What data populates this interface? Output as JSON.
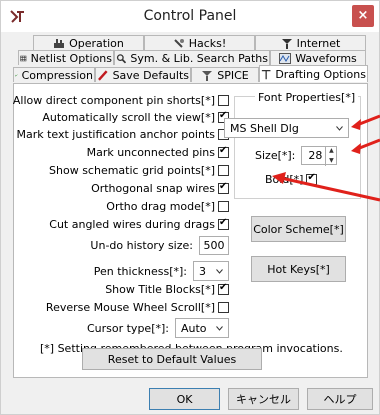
{
  "window": {
    "title": "Control Panel",
    "close_symbol": "×",
    "app_icon": "app-logo-icon"
  },
  "tabs": {
    "row1": [
      {
        "label": "Operation",
        "icon": "operation-icon"
      },
      {
        "label": "Hacks!",
        "icon": "hacks-icon"
      },
      {
        "label": "Internet",
        "icon": "internet-icon"
      }
    ],
    "row2": [
      {
        "label": "Netlist Options",
        "icon": "netlist-icon"
      },
      {
        "label": "Sym. & Lib. Search Paths",
        "icon": "search-icon"
      },
      {
        "label": "Waveforms",
        "icon": "waveforms-icon"
      }
    ],
    "row3": [
      {
        "label": "Compression",
        "icon": "compression-icon"
      },
      {
        "label": "Save Defaults",
        "icon": "pencil-icon"
      },
      {
        "label": "SPICE",
        "icon": "spice-icon"
      },
      {
        "label": "Drafting Options",
        "icon": "drafting-icon",
        "active": true
      }
    ]
  },
  "options": {
    "allow_shorts": {
      "label": "Allow direct component pin shorts[*]",
      "checked": false
    },
    "auto_scroll": {
      "label": "Automatically scroll the view[*]",
      "checked": true
    },
    "mark_anchor": {
      "label": "Mark text justification anchor points",
      "checked": false
    },
    "mark_unconnected": {
      "label": "Mark unconnected pins",
      "checked": true
    },
    "show_grid": {
      "label": "Show schematic grid points[*]",
      "checked": false
    },
    "ortho_snap": {
      "label": "Orthogonal snap wires",
      "checked": true
    },
    "ortho_drag": {
      "label": "Ortho drag mode[*]",
      "checked": false
    },
    "cut_angled": {
      "label": "Cut angled wires during drags",
      "checked": true
    },
    "undo_history": {
      "label": "Un-do history size:",
      "value": "500"
    },
    "pen_thickness": {
      "label": "Pen thickness[*]:",
      "value": "3"
    },
    "show_title": {
      "label": "Show Title Blocks[*]",
      "checked": true
    },
    "reverse_scroll": {
      "label": "Reverse Mouse Wheel Scroll[*]",
      "checked": false
    },
    "cursor_type": {
      "label": "Cursor type[*]:",
      "value": "Auto"
    }
  },
  "font_properties": {
    "title": "Font Properties[*]",
    "font": "MS Shell Dlg",
    "size_label": "Size[*]:",
    "size": "28",
    "bold_label": "Bold[*]",
    "bold_checked": true
  },
  "side_buttons": {
    "color_scheme": "Color Scheme[*]",
    "hot_keys": "Hot Keys[*]"
  },
  "note": "[*] Setting remembered between program invocations.",
  "reset_button": "Reset to Default Values",
  "footer": {
    "ok": "OK",
    "cancel": "キャンセル",
    "help": "ヘルプ"
  },
  "colors": {
    "annotation_arrow": "#e0211b",
    "close_button": "#c8504e"
  }
}
